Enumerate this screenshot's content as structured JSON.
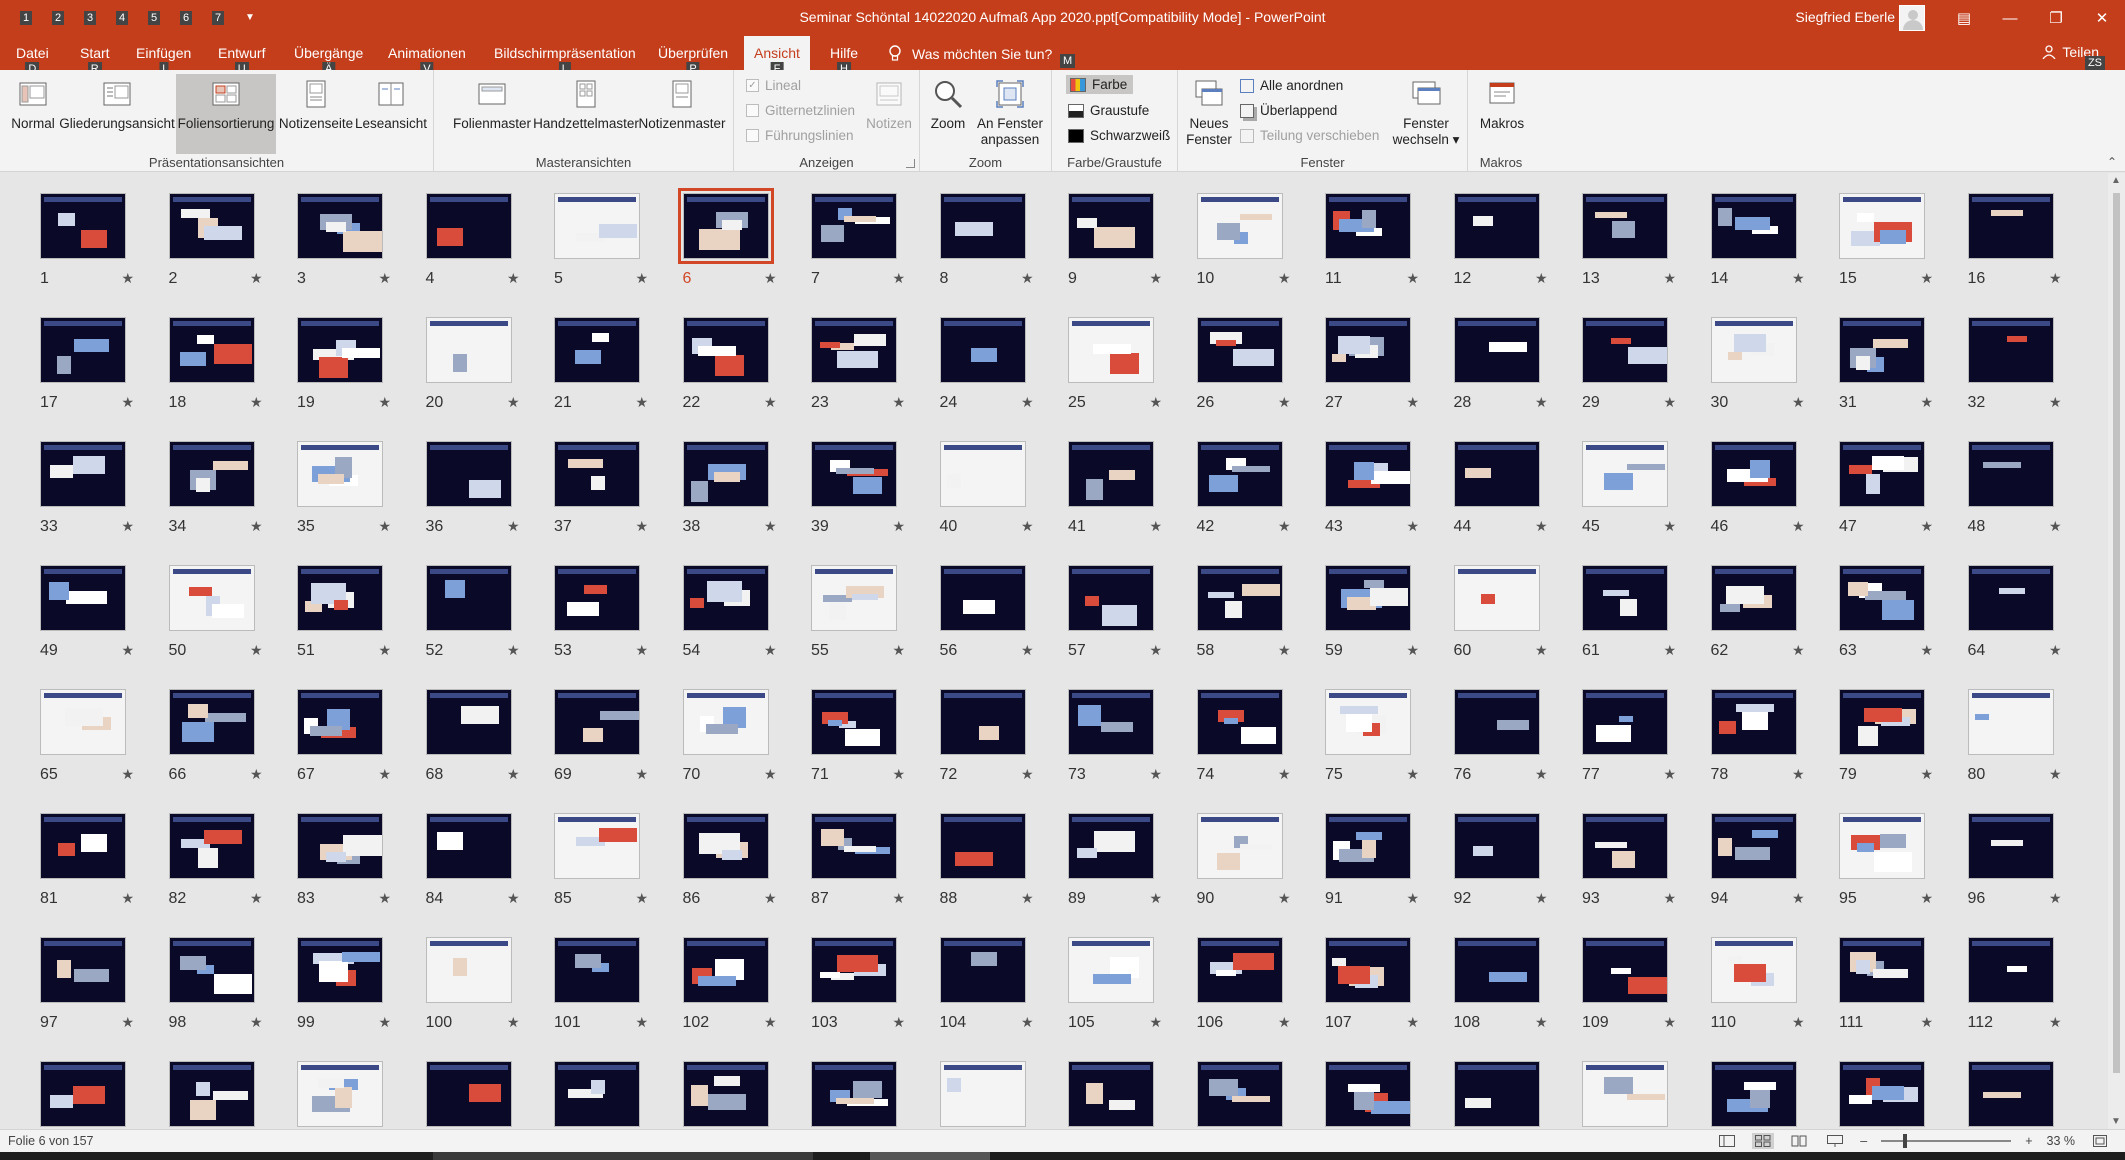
{
  "window": {
    "title": "Seminar Schöntal 14022020 Aufmaß App 2020.ppt[Compatibility Mode] - PowerPoint",
    "user": "Siegfried Eberle",
    "qat_keys": [
      "1",
      "2",
      "3",
      "4",
      "5",
      "6",
      "7"
    ]
  },
  "tabs": [
    {
      "label": "Datei",
      "key": "D"
    },
    {
      "label": "Start",
      "key": "R"
    },
    {
      "label": "Einfügen",
      "key": "I"
    },
    {
      "label": "Entwurf",
      "key": "U"
    },
    {
      "label": "Übergänge",
      "key": "Ä"
    },
    {
      "label": "Animationen",
      "key": "V"
    },
    {
      "label": "Bildschirmpräsentation",
      "key": "L"
    },
    {
      "label": "Überprüfen",
      "key": "P"
    },
    {
      "label": "Ansicht",
      "key": "F"
    },
    {
      "label": "Hilfe",
      "key": "H"
    }
  ],
  "tell_me": "Was möchten Sie tun?",
  "tell_key": "M",
  "share": "Teilen",
  "share_key": "ZS",
  "ribbon": {
    "presentation_views": {
      "label": "Präsentationsansichten",
      "normal": "Normal",
      "outline": "Gliederungsansicht",
      "sorter": "Foliensortierung",
      "notes_page": "Notizenseite",
      "reading": "Leseansicht"
    },
    "master_views": {
      "label": "Masteransichten",
      "slide_master": "Folienmaster",
      "handout_master": "Handzettelmaster",
      "notes_master": "Notizenmaster"
    },
    "show": {
      "label": "Anzeigen",
      "ruler": "Lineal",
      "gridlines": "Gitternetzlinien",
      "guides": "Führungslinien",
      "notes": "Notizen"
    },
    "zoom": {
      "label": "Zoom",
      "zoom": "Zoom",
      "fit_line1": "An Fenster",
      "fit_line2": "anpassen"
    },
    "color": {
      "label": "Farbe/Graustufe",
      "color": "Farbe",
      "grayscale": "Graustufe",
      "bw": "Schwarzweiß"
    },
    "window": {
      "label": "Fenster",
      "new_line1": "Neues",
      "new_line2": "Fenster",
      "arrange_all": "Alle anordnen",
      "cascade": "Überlappend",
      "move_split": "Teilung verschieben",
      "switch_line1": "Fenster",
      "switch_line2": "wechseln"
    },
    "macros": {
      "label": "Makros",
      "macros": "Makros"
    }
  },
  "sorter": {
    "current_slide": 6,
    "visible_slides": 128
  },
  "status": {
    "slide_info": "Folie 6 von 157",
    "zoom": "33 %"
  },
  "colors": {
    "accent": "#c43e1c",
    "current_outline": "#d24726",
    "slide_bg": "#0a0a28"
  }
}
